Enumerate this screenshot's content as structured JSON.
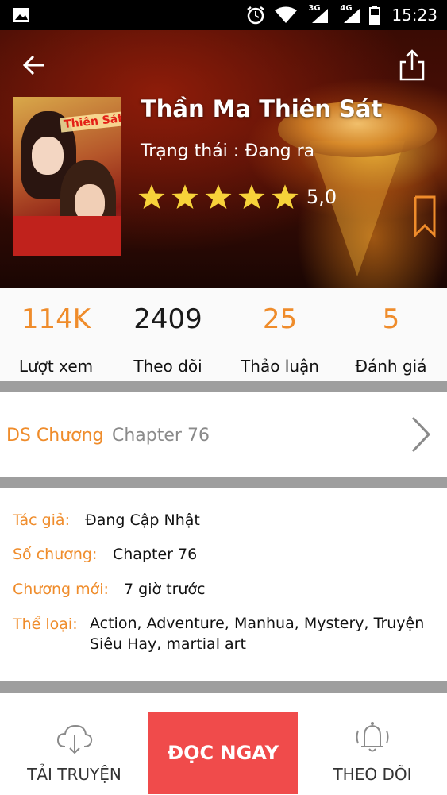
{
  "status_bar": {
    "time": "15:23",
    "network_1": "3G",
    "network_2": "4G",
    "icons": [
      "image-icon",
      "alarm-icon",
      "wifi-icon",
      "signal-icon",
      "signal-icon",
      "battery-icon"
    ]
  },
  "header": {
    "title": "Thần Ma Thiên Sát",
    "status": "Trạng thái : Đang ra",
    "rating_value": "5,0",
    "rating_stars": 5,
    "cover_text": "Thiên Sát Thần",
    "icons": [
      "back-arrow-icon",
      "share-icon",
      "bookmark-icon",
      "star-icon"
    ]
  },
  "stats": [
    {
      "value": "114K",
      "label": "Lượt xem",
      "color": "#ef8c2b"
    },
    {
      "value": "2409",
      "label": "Theo dõi",
      "color": "#1a1a1a"
    },
    {
      "value": "25",
      "label": "Thảo luận",
      "color": "#ef8c2b"
    },
    {
      "value": "5",
      "label": "Đánh giá",
      "color": "#ef8c2b"
    }
  ],
  "chapters": {
    "label": "DS Chương",
    "latest": "Chapter 76"
  },
  "info": {
    "author_label": "Tác giả:",
    "author": "Đang Cập Nhật",
    "chapter_count_label": "Số chương:",
    "chapter_count": "Chapter 76",
    "new_chapter_label": "Chương mới:",
    "new_chapter": "7 giờ trước",
    "genre_label": "Thể loại:",
    "genres": "Action, Adventure, Manhua, Mystery, Truyện Siêu Hay, martial art"
  },
  "bottom_bar": {
    "download": "TẢI TRUYỆN",
    "read_now": "ĐỌC NGAY",
    "follow": "THEO DÕI"
  },
  "colors": {
    "accent": "#ef8c2b",
    "primary_button": "#f04b4b",
    "divider": "#9e9e9e",
    "star": "#f7d23a"
  }
}
